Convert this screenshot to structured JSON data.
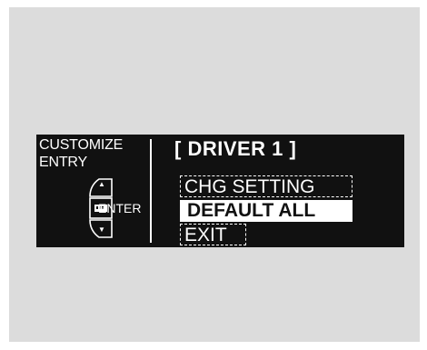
{
  "screen": {
    "title_line1": "CUSTOMIZE",
    "title_line2": "ENTRY",
    "driver_title": "[ DRIVER 1 ]",
    "enter_label": "ENTER",
    "up_arrow": "▲",
    "down_arrow": "▼"
  },
  "menu": {
    "items": [
      {
        "label": "CHG SETTING",
        "selected": false
      },
      {
        "label": "DEFAULT ALL",
        "selected": true
      },
      {
        "label": "EXIT",
        "selected": false
      }
    ]
  },
  "colors": {
    "background": "#dcdcdc",
    "display": "#111111",
    "text": "#ffffff"
  },
  "icons": [
    "selector-dial-icon",
    "enter-button-icon",
    "up-arrow-icon",
    "down-arrow-icon"
  ]
}
